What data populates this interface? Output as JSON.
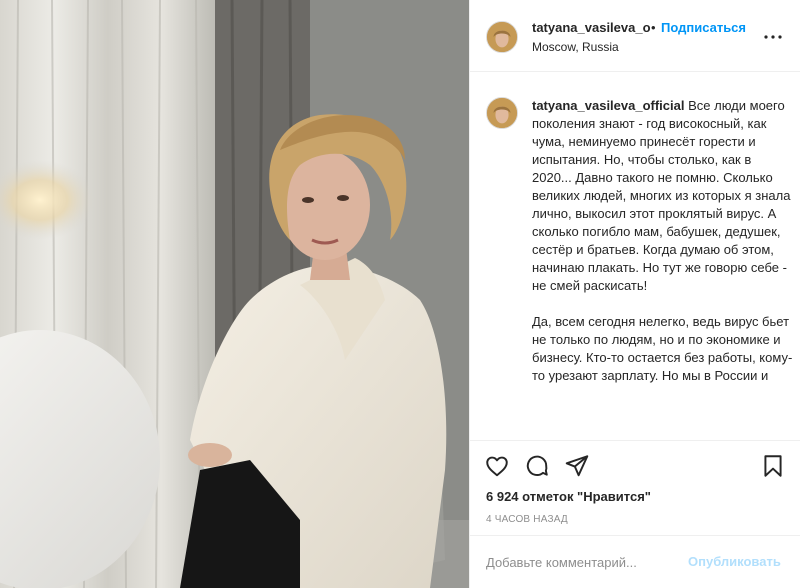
{
  "post": {
    "photo": {
      "subject_icon": "woman-portrait-photo"
    }
  },
  "header": {
    "username": "tatyana_vasileva_official",
    "dot": "•",
    "follow_label": "Подписаться",
    "location": "Moscow, Russia",
    "more_icon": "more-horizontal-icon"
  },
  "caption": {
    "username": "tatyana_vasileva_official",
    "paragraph1": "Все люди моего поколения знают - год високосный, как чума, неминуемо принесёт горести и испытания. Но, чтобы столько, как в 2020... Давно такого не помню. Сколько великих людей, многих из которых я знала лично, выкосил этот проклятый вирус. А сколько погибло мам, бабушек, дедушек, сестёр и братьев. Когда думаю об этом, начинаю плакать. Но тут же говорю себе - не смей раскисать!",
    "paragraph2": "Да, всем сегодня нелегко, ведь вирус бьет не только по людям, но и по экономике и бизнесу. Кто-то остается без работы, кому-то урезают зарплату. Но мы в России и"
  },
  "actions": {
    "icons": [
      "heart-icon",
      "comment-icon",
      "share-icon",
      "bookmark-icon"
    ],
    "likes": "6 924 отметок \"Нравится\"",
    "timestamp": "4 часов назад"
  },
  "comment": {
    "placeholder": "Добавьте комментарий...",
    "publish_label": "Опубликовать"
  },
  "colors": {
    "accent": "#0095f6",
    "publish_disabled": "#b2dffc",
    "text": "#262626",
    "muted": "#8e8e8e",
    "border": "#efefef"
  }
}
